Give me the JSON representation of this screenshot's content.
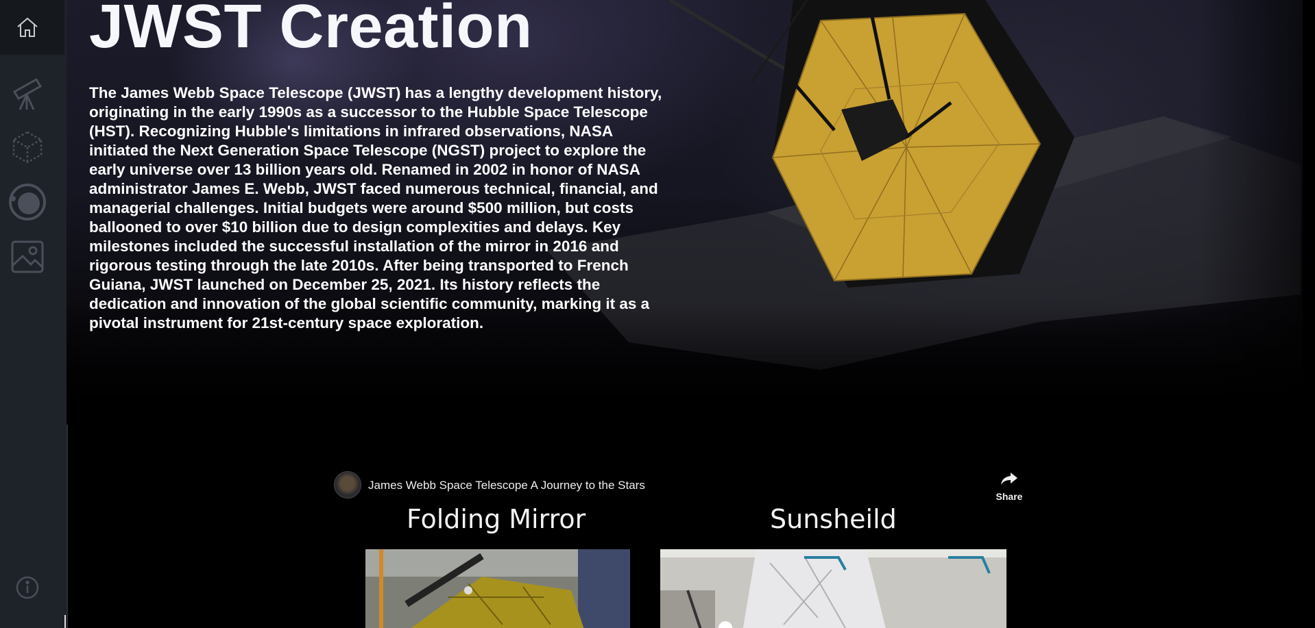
{
  "page": {
    "title": "JWST Creation",
    "history": "The James Webb Space Telescope (JWST) has a lengthy development history, originating in the early 1990s as a successor to the Hubble Space Telescope (HST). Recognizing Hubble's limitations in infrared observations, NASA initiated the Next Generation Space Telescope (NGST) project to explore the early universe over 13 billion years old. Renamed in 2002 in honor of NASA administrator James E. Webb, JWST faced numerous technical, financial, and managerial challenges. Initial budgets were around $500 million, but costs ballooned to over $10 billion due to design complexities and delays. Key milestones included the successful installation of the mirror in 2016 and rigorous testing through the late 2010s. After being transported to French Guiana, JWST launched on December 25, 2021. Its history reflects the dedication and innovation of the global scientific community, marking it as a pivotal instrument for 21st-century space exploration."
  },
  "sidebar": {
    "items": [
      {
        "icon": "home-icon"
      },
      {
        "icon": "telescope-icon"
      },
      {
        "icon": "cube-icon"
      },
      {
        "icon": "planet-icon"
      },
      {
        "icon": "image-icon"
      },
      {
        "icon": "info-icon"
      }
    ]
  },
  "video": {
    "title": "James Webb Space Telescope A Journey to the Stars",
    "share_label": "Share",
    "panels": [
      {
        "title": "Folding Mirror"
      },
      {
        "title": "Sunsheild"
      }
    ]
  },
  "colors": {
    "sidebar_bg": "#1e2229",
    "sidebar_active": "#15181d",
    "icon": "#4a4f59",
    "mirror_gold": "#c9a032"
  }
}
